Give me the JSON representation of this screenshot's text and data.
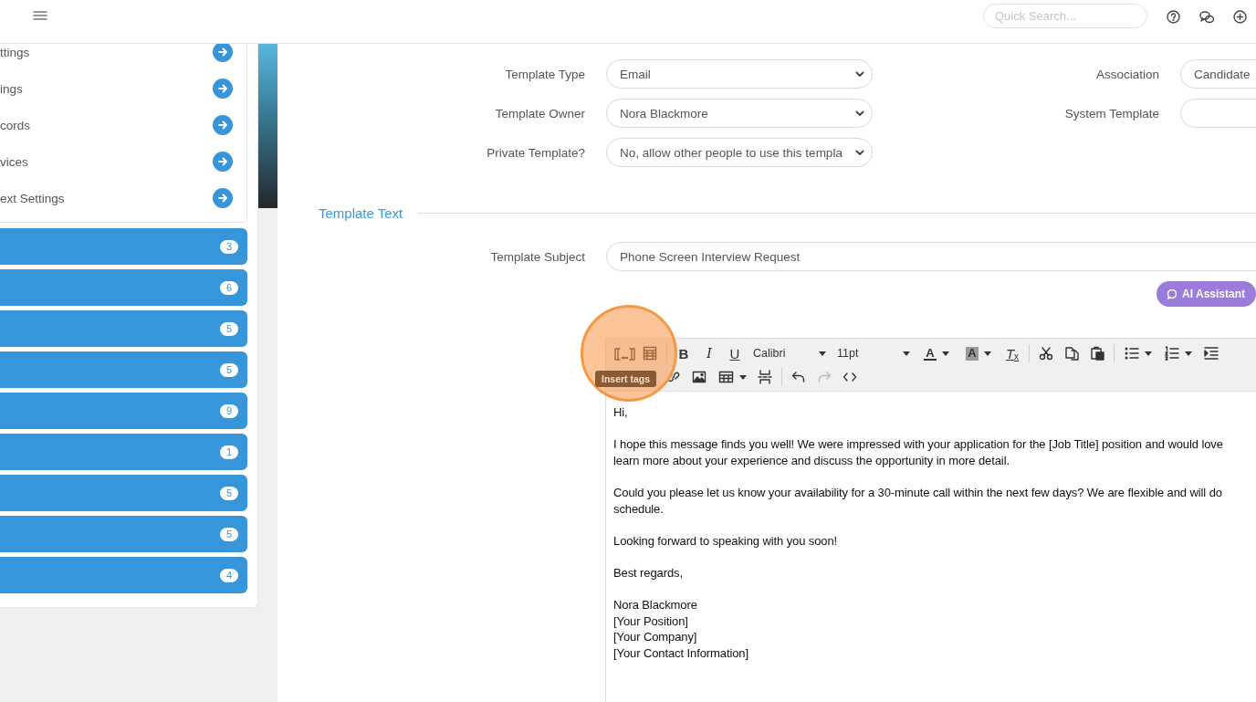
{
  "topbar": {
    "search": {
      "placeholder": "Quick Search..."
    }
  },
  "sidebar": {
    "links": [
      {
        "label": "ttings"
      },
      {
        "label": "ings"
      },
      {
        "label": "cords"
      },
      {
        "label": "vices"
      },
      {
        "label": "ext Settings"
      }
    ],
    "groups": [
      {
        "count": "3"
      },
      {
        "count": "6"
      },
      {
        "count": "5"
      },
      {
        "count": "5"
      },
      {
        "count": "9"
      },
      {
        "count": "1"
      },
      {
        "count": "5"
      },
      {
        "count": "5"
      },
      {
        "count": "4"
      }
    ]
  },
  "form": {
    "rows": [
      {
        "left": {
          "label": "Template Type",
          "value": "Email"
        },
        "right": {
          "label": "Association",
          "value": "Candidate"
        }
      },
      {
        "left": {
          "label": "Template Owner",
          "value": "Nora Blackmore"
        },
        "right": {
          "label": "System Template"
        }
      },
      {
        "left": {
          "label": "Private Template?",
          "value": "No, allow other people to use this templa"
        }
      }
    ]
  },
  "section": {
    "title": "Template Text"
  },
  "subject": {
    "label": "Template Subject",
    "value": "Phone Screen Interview Request"
  },
  "ai_button": {
    "label": "AI Assistant"
  },
  "toolbar": {
    "rows": [
      [
        {
          "kind": "icon"
        },
        {
          "kind": "icon"
        },
        {
          "kind": "letter",
          "text": "B"
        },
        {
          "kind": "letter",
          "text": "I"
        },
        {
          "kind": "letter",
          "text": "U"
        },
        {
          "kind": "dropdown",
          "text": "Calibri"
        },
        {
          "kind": "dropdown",
          "text": "11pt"
        },
        {
          "kind": "text-color",
          "text": "A"
        },
        {
          "kind": "highlight-color",
          "text": "A"
        },
        {
          "kind": "clear",
          "text": "T",
          "mark": "x"
        },
        {
          "kind": "icon"
        },
        {
          "kind": "icon"
        },
        {
          "kind": "icon"
        },
        {
          "kind": "split"
        },
        {
          "kind": "split"
        },
        {
          "kind": "icon"
        }
      ],
      [
        {
          "kind": "icon"
        },
        {
          "kind": "icon"
        },
        {
          "kind": "split"
        },
        {
          "kind": "icon"
        },
        {
          "kind": "icon"
        },
        {
          "kind": "icon",
          "disabled": true
        },
        {
          "kind": "icon"
        }
      ]
    ]
  },
  "tooltip": {
    "text": "Insert tags"
  },
  "body": [
    [
      "Hi,"
    ],
    [
      "I hope this message finds you well! We were impressed with your application for the [Job Title] position and would love",
      "learn more about your experience and discuss the opportunity in more detail."
    ],
    [
      "Could you please let us know your availability for a 30-minute call within the next few days? We are flexible and will do",
      "schedule."
    ],
    [
      "Looking forward to speaking with you soon!"
    ],
    [
      "Best regards,"
    ],
    [
      "Nora Blackmore",
      "[Your Position]",
      "[Your Company]",
      "[Your Contact Information]"
    ]
  ]
}
